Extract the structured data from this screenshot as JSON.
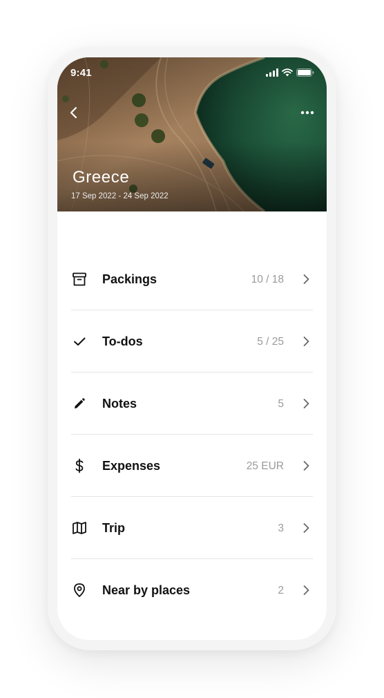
{
  "status_bar": {
    "time": "9:41"
  },
  "header": {
    "back_icon": "chevron-left-icon",
    "more_icon": "more-horizontal-icon",
    "title": "Greece",
    "dates": "17 Sep 2022 - 24 Sep 2022"
  },
  "menu": {
    "items": [
      {
        "icon": "archive-box-icon",
        "label": "Packings",
        "count": "10 / 18"
      },
      {
        "icon": "check-icon",
        "label": "To-dos",
        "count": "5 / 25"
      },
      {
        "icon": "pencil-icon",
        "label": "Notes",
        "count": "5"
      },
      {
        "icon": "dollar-icon",
        "label": "Expenses",
        "count": "25 EUR"
      },
      {
        "icon": "map-icon",
        "label": "Trip",
        "count": "3"
      },
      {
        "icon": "location-pin-icon",
        "label": "Near by places",
        "count": "2"
      }
    ]
  },
  "colors": {
    "text_primary": "#111111",
    "text_secondary": "#9a9a9a",
    "divider": "#e5e5e5",
    "water": "#1f5a3c",
    "sand": "#9c7b5a"
  }
}
